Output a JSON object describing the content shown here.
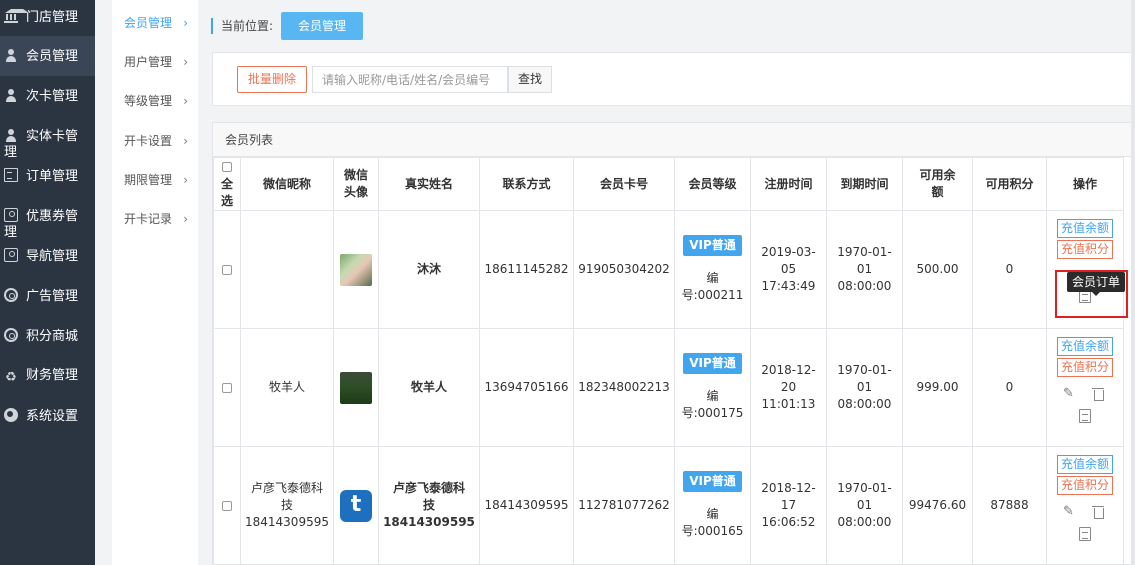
{
  "sidebar": {
    "items": [
      {
        "label": "门店管理",
        "icon": "bank-icon"
      },
      {
        "label": "会员管理",
        "icon": "user-icon"
      },
      {
        "label": "次卡管理",
        "icon": "user-icon"
      },
      {
        "label": "实体卡管",
        "label2": "理",
        "icon": "user-icon"
      },
      {
        "label": "订单管理",
        "icon": "document-icon"
      },
      {
        "label": "优惠券管",
        "label2": "理",
        "icon": "ticket-icon"
      },
      {
        "label": "导航管理",
        "icon": "ticket-icon"
      },
      {
        "label": "广告管理",
        "icon": "lifebuoy-icon"
      },
      {
        "label": "积分商城",
        "icon": "lifebuoy-icon"
      },
      {
        "label": "财务管理",
        "icon": "recycle-icon"
      },
      {
        "label": "系统设置",
        "icon": "gear-icon"
      }
    ],
    "active_index": 1
  },
  "subnav": {
    "items": [
      {
        "label": "会员管理",
        "chevron": "›"
      },
      {
        "label": "用户管理",
        "chevron": "›"
      },
      {
        "label": "等级管理",
        "chevron": "›"
      },
      {
        "label": "开卡设置",
        "chevron": "›"
      },
      {
        "label": "期限管理",
        "chevron": "›"
      },
      {
        "label": "开卡记录",
        "chevron": "›"
      }
    ],
    "active_index": 0
  },
  "breadcrumb": {
    "label": "当前位置:",
    "current": "会员管理"
  },
  "toolbar": {
    "batch_delete": "批量删除",
    "search_placeholder": "请输入昵称/电话/姓名/会员编号",
    "search_button": "查找"
  },
  "list": {
    "title": "会员列表",
    "columns": {
      "select_all_1": "全",
      "select_all_2": "选",
      "nickname": "微信昵称",
      "avatar_1": "微信",
      "avatar_2": "头像",
      "real_name": "真实姓名",
      "phone": "联系方式",
      "card_no": "会员卡号",
      "level": "会员等级",
      "reg_time": "注册时间",
      "expire_time": "到期时间",
      "balance_1": "可用余",
      "balance_2": "额",
      "points": "可用积分",
      "actions": "操作"
    },
    "rows": [
      {
        "nickname_1": "",
        "nickname_2": "",
        "avatar": "photo-avatar-couple",
        "real_name_1": "沐沐",
        "real_name_2": "",
        "phone": "18611145282",
        "card_no": "919050304202",
        "level": "VIP普通",
        "code_1": "编",
        "code_2": "号:000211",
        "reg_1": "2019-03-",
        "reg_2": "05",
        "reg_3": "17:43:49",
        "exp_1": "1970-01-",
        "exp_2": "01",
        "exp_3": "08:00:00",
        "balance": "500.00",
        "points": "0"
      },
      {
        "nickname_1": "牧羊人",
        "nickname_2": "",
        "avatar": "photo-avatar-field",
        "real_name_1": "牧羊人",
        "real_name_2": "",
        "phone": "13694705166",
        "card_no": "182348002213",
        "level": "VIP普通",
        "code_1": "编",
        "code_2": "号:000175",
        "reg_1": "2018-12-",
        "reg_2": "20",
        "reg_3": "11:01:13",
        "exp_1": "1970-01-",
        "exp_2": "01",
        "exp_3": "08:00:00",
        "balance": "999.00",
        "points": "0"
      },
      {
        "nickname_1": "卢彦飞泰德科",
        "nickname_2": "技",
        "nickname_3": "18414309595",
        "avatar": "logo-avatar-t",
        "real_name_1": "卢彦飞泰德科",
        "real_name_2": "技",
        "real_name_3": "18414309595",
        "phone": "18414309595",
        "card_no": "112781077262",
        "level": "VIP普通",
        "code_1": "编",
        "code_2": "号:000165",
        "reg_1": "2018-12-",
        "reg_2": "17",
        "reg_3": "16:06:52",
        "exp_1": "1970-01-",
        "exp_2": "01",
        "exp_3": "08:00:00",
        "balance": "99476.60",
        "points": "87888"
      }
    ],
    "actions": {
      "recharge_balance": "充值余额",
      "recharge_points": "充值积分"
    }
  },
  "tooltip": {
    "text": "会员订单"
  },
  "colors": {
    "sidebar_bg": "#2b3542",
    "accent_blue": "#41a6ee",
    "accent_orange": "#ea7453",
    "highlight_red": "#e02020"
  }
}
